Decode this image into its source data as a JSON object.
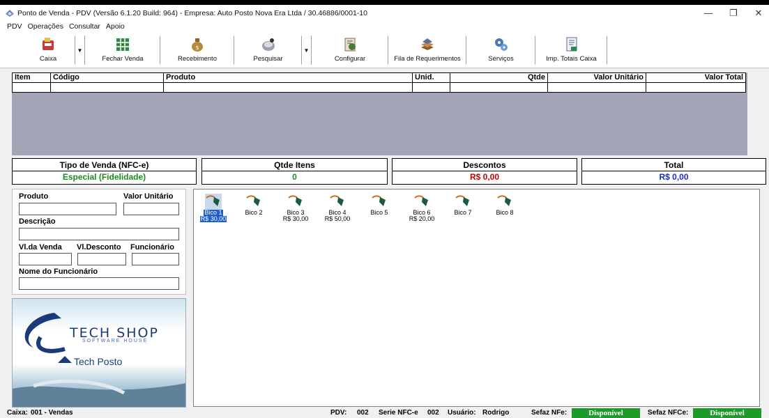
{
  "window": {
    "title": "Ponto de Venda - PDV (Versão 6.1.20 Build: 964) - Empresa: Auto Posto Nova Era Ltda / 30.46\u0000\u0000886/0001-10",
    "minimize": "—",
    "maximize": "❐",
    "close": "✕"
  },
  "menu": [
    "PDV",
    "Operações",
    "Consultar",
    "Apoio"
  ],
  "toolbar": {
    "caixa": "Caixa",
    "fechar_venda": "Fechar Venda",
    "recebimento": "Recebimento",
    "pesquisar": "Pesquisar",
    "configurar": "Configurar",
    "fila_requerimentos": "Fila de Requerimentos",
    "servicos": "Serviços",
    "imp_totais_caixa": "Imp. Totais Caixa",
    "dropdown_arrow": "▼"
  },
  "grid": {
    "columns": [
      "Item",
      "Código",
      "Produto",
      "Unid.",
      "Qtde",
      "Valor Unitário",
      "Valor Total"
    ]
  },
  "summary": {
    "tipo_venda_label": "Tipo de Venda (NFC-e)",
    "tipo_venda_value": "Especial (Fidelidade)",
    "qtde_itens_label": "Qtde Itens",
    "qtde_itens_value": "0",
    "descontos_label": "Descontos",
    "descontos_value": "R$ 0,00",
    "total_label": "Total",
    "total_value": "R$ 0,00",
    "colors": {
      "green": "#1a8a1a",
      "red": "#c00000",
      "blue": "#1a2cc8"
    }
  },
  "form": {
    "produto": "Produto",
    "valor_unitario": "Valor Unitário",
    "descricao": "Descrição",
    "vl_venda": "Vl.da Venda",
    "vl_desconto": "Vl.Desconto",
    "funcionario": "Funcionário",
    "nome_funcionario": "Nome do Funcionário"
  },
  "logo": {
    "brand": "TECH SHOP",
    "tagline": "SOFTWARE HOUSE",
    "product": "Tech Posto"
  },
  "bicos": [
    {
      "name": "Bico 1",
      "price": "R$ 30,00",
      "selected": true
    },
    {
      "name": "Bico 2",
      "price": ""
    },
    {
      "name": "Bico 3",
      "price": "R$ 30,00"
    },
    {
      "name": "Bico 4",
      "price": "R$ 50,00"
    },
    {
      "name": "Bico 5",
      "price": ""
    },
    {
      "name": "Bico 6",
      "price": "R$ 20,00"
    },
    {
      "name": "Bico 7",
      "price": ""
    },
    {
      "name": "Bico 8",
      "price": ""
    }
  ],
  "status": {
    "caixa_label": "Caixa:",
    "caixa_value": "001 - Vendas",
    "pdv_label": "PDV:",
    "pdv_value": "002",
    "serie_label": "Serie NFC-e",
    "serie_value": "002",
    "usuario_label": "Usuário:",
    "usuario_value": "Rodrigo",
    "sefaz_nfe_label": "Sefaz NFe:",
    "sefaz_nfe_value": "Disponível",
    "sefaz_nfce_label": "Sefaz NFCe:",
    "sefaz_nfce_value": "Disponível"
  }
}
